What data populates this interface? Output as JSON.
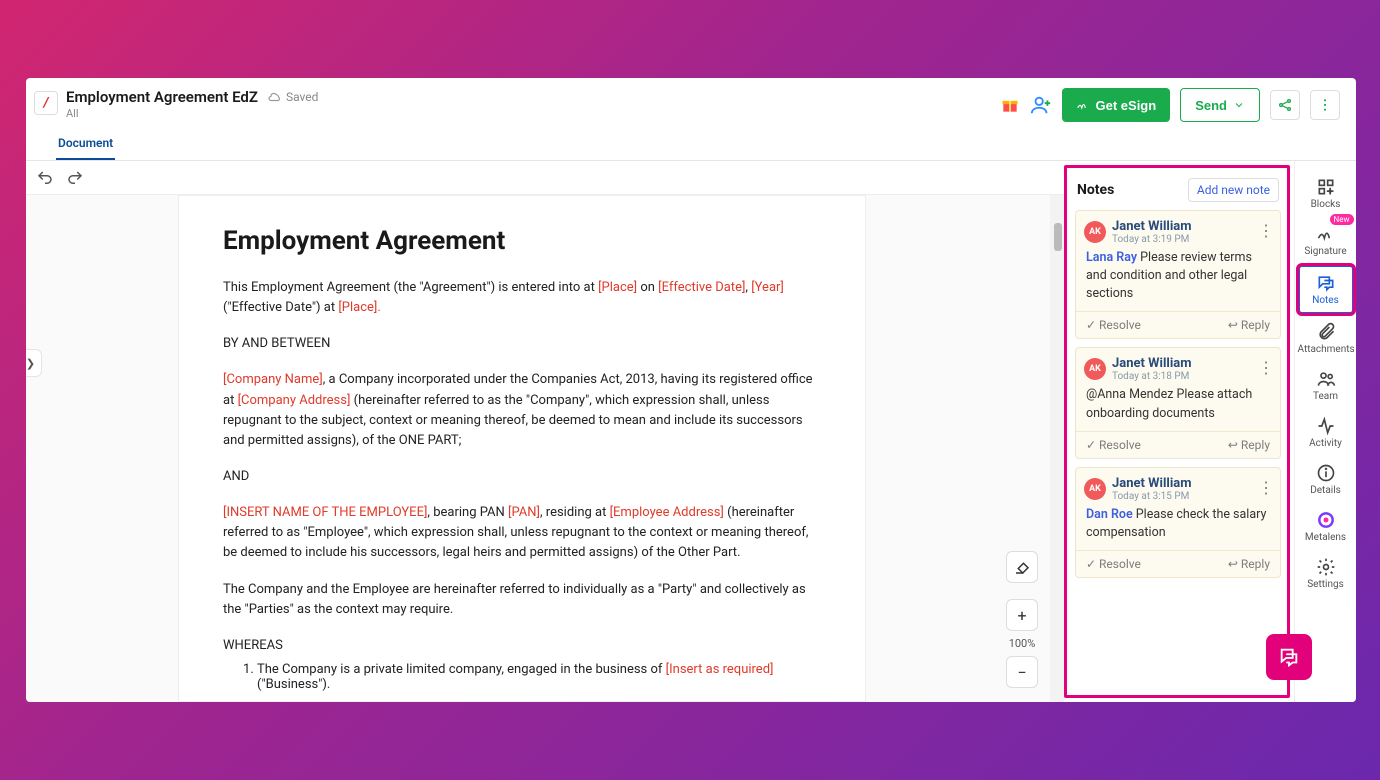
{
  "header": {
    "title": "Employment Agreement EdZ",
    "saved_label": "Saved",
    "subtitle": "All",
    "tab": "Document",
    "get_esign": "Get eSign",
    "send": "Send"
  },
  "document": {
    "heading": "Employment Agreement",
    "intro_1": "This Employment Agreement (the \"Agreement\") is entered into at ",
    "ph_place1": "[Place]",
    "intro_on": " on ",
    "ph_effdate": "[Effective Date]",
    "comma": ", ",
    "ph_year": "[Year]",
    "intro_2": " (\"Effective Date\") at ",
    "ph_place2": "[Place].",
    "between": "BY AND BETWEEN",
    "ph_company_name": "[Company Name]",
    "company_clause_1": ", a Company incorporated under the Companies Act, 2013, having its registered office at ",
    "ph_company_addr": "[Company Address]",
    "company_clause_2": " (hereinafter referred to as the \"Company\", which expression shall, unless repugnant to the subject, context or meaning thereof, be deemed to mean and include its successors and permitted assigns), of the ONE PART;",
    "and": "AND",
    "ph_emp_name": "[INSERT NAME OF THE EMPLOYEE]",
    "emp_clause_1": ", bearing PAN ",
    "ph_pan": "[PAN]",
    "emp_clause_2": ", residing at ",
    "ph_emp_addr": "[Employee Address]",
    "emp_clause_3": " (hereinafter referred to as \"Employee\", which expression shall, unless repugnant to the context or meaning thereof, be deemed to include his successors, legal heirs and permitted assigns) of the Other Part.",
    "parties": "The Company and the Employee are hereinafter referred to individually as a \"Party\" and collectively as the \"Parties\" as the context may require.",
    "whereas": "WHEREAS",
    "li1_a": "The Company is a private limited company, engaged in the business of ",
    "ph_insert": "[Insert as required]",
    "li1_b": " (\"Business\")."
  },
  "zoom_label": "100%",
  "notes": {
    "title": "Notes",
    "add_label": "Add new note",
    "resolve": "Resolve",
    "reply": "Reply",
    "items": [
      {
        "avatar": "AK",
        "author": "Janet William",
        "time": "Today at 3:19 PM",
        "mention": "Lana Ray",
        "body": " Please review terms and condition and other legal sections"
      },
      {
        "avatar": "AK",
        "author": "Janet William",
        "time": "Today at 3:18 PM",
        "mention": "",
        "body": "@Anna Mendez Please attach onboarding documents"
      },
      {
        "avatar": "AK",
        "author": "Janet William",
        "time": "Today at 3:15 PM",
        "mention": "Dan Roe",
        "body": " Please check the salary compensation"
      }
    ]
  },
  "right_nav": {
    "blocks": "Blocks",
    "signature": "Signature",
    "new_badge": "New",
    "notes": "Notes",
    "attachments": "Attachments",
    "team": "Team",
    "activity": "Activity",
    "details": "Details",
    "metalens": "Metalens",
    "settings": "Settings"
  }
}
